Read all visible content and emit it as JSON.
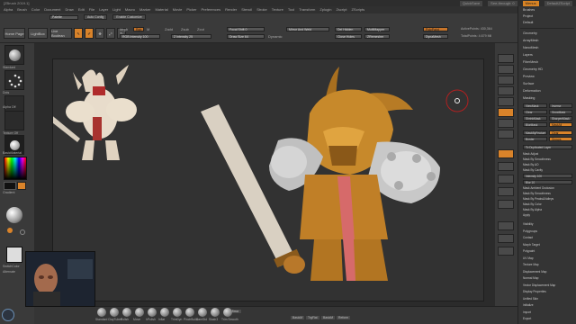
{
  "app": {
    "title": "[ZBrush 2019.1]",
    "quicksave": "QuickSave",
    "see_through": "See-through: 0",
    "menus_label": "Menus",
    "default_script": "DefaultZScript"
  },
  "menu": [
    "Alpha",
    "Brush",
    "Color",
    "Document",
    "Draw",
    "Edit",
    "File",
    "Layer",
    "Light",
    "Macro",
    "Marker",
    "Material",
    "Movie",
    "Picker",
    "Preferences",
    "Render",
    "Stencil",
    "Stroke",
    "Texture",
    "Tool",
    "Transform",
    "Zplugin",
    "Zscript",
    "ZScripts"
  ],
  "toolbar1": {
    "palette": "Palette",
    "mode": "Auto Config",
    "enable": "Enable Customize"
  },
  "shelf": {
    "home_page": "Home Page",
    "lightbox": "LightBox",
    "live_boolean": "Live Boolean",
    "edit": "Edit",
    "draw": "Draw",
    "move": "Move",
    "scale": "Scale",
    "rotate": "Rotate",
    "mrgb": "Mrgb",
    "rgb": "Rgb",
    "m": "M",
    "rgb_intensity": "RGB Intensity 100",
    "zadd": "Zadd",
    "zsub": "Zsub",
    "zcut": "Zcut",
    "z_intensity": "Z Intensity 25",
    "focal_shift": "Focal Shift 0",
    "draw_size": "Draw Size 64",
    "dynamic": "Dynamic",
    "mirror_weld": "Mirror And Weld",
    "del_hidden": "Del Hidden",
    "close_holes": "Close Holes",
    "multimapper": "MultiMapper",
    "zremesher": "ZRemesher",
    "active_points": "ActivePoints: 430,364",
    "total_points": "TotalPoints: 4.679 Mil",
    "polypaint": "PolyPaint",
    "dynamesh": "DynaMesh"
  },
  "leftbar": {
    "brush_label": "Standard",
    "stroke_label": "Dots",
    "alpha_label": "Alpha Off",
    "texture_label": "Texture Off",
    "material_label": "BasicMaterial",
    "gradient_label": "Gradient",
    "switch_color": "SwitchColor",
    "alternate": "Alternate"
  },
  "panel": {
    "top_items": [
      "Brushes",
      "Project",
      "Default"
    ],
    "items": [
      "Geometry",
      "ArrayMesh",
      "NanoMesh",
      "Layers",
      "FiberMesh",
      "Geometry HD",
      "Preview",
      "Surface",
      "Deformation",
      "Masking"
    ],
    "masking": {
      "view_mask": "ViewMask",
      "inverse": "Inverse",
      "clear": "Clear",
      "grow": "GrowMask",
      "shrink": "ShrinkMask",
      "sharpen": "SharpenMask",
      "blur": "BlurMask",
      "mask_all": "MaskAll",
      "clear2": "Clear",
      "mask_by_feature": "MaskByFeature",
      "border": "Border",
      "groups": "Groups",
      "crease": "Crease",
      "fibermesh_mask": "FiberMesh Mask",
      "dup_mask": "To Duplicated Layer"
    },
    "mask_items": [
      "Mask Adjust",
      "Mask By Smoothness",
      "Mask By AO",
      "Mask By Cavity",
      "Mask Ambient Occlusion",
      "Mask By Smoothness",
      "Mask By Peaks&Valleys",
      "Mask By Color",
      "Mask By Alpha",
      "Apply"
    ],
    "intensity": "Intensity 100",
    "blur": "Blur 10",
    "bottom_items": [
      "Visibility",
      "Polygroups",
      "Contact",
      "Morph Target",
      "Polypaint",
      "UV Map",
      "Texture Map",
      "Displacement Map",
      "Normal Map",
      "Vector Displacement Map",
      "Display Properties",
      "Unified Skin",
      "Initialize",
      "Import",
      "Export"
    ]
  },
  "status": {
    "tools": [
      "Standard",
      "ClayTubes",
      "Polish",
      "Move",
      "hPolish",
      "Inflat",
      "TrimDyn",
      "PinchBuild",
      "DamStd",
      "Slash3",
      "Trim Smooth",
      "Hpolish"
    ],
    "mode": "Mirror",
    "symmetry": "Basic",
    "bottom_bar": [
      "BasicM",
      "TrgFlat",
      "BasicM",
      "Reform"
    ]
  },
  "colors": {
    "accent": "#d9832a",
    "bg": "#3a3a3a",
    "canvas": "#2b2b2b",
    "gold_model": "#c7892b",
    "ivory_model": "#e8dccb"
  }
}
